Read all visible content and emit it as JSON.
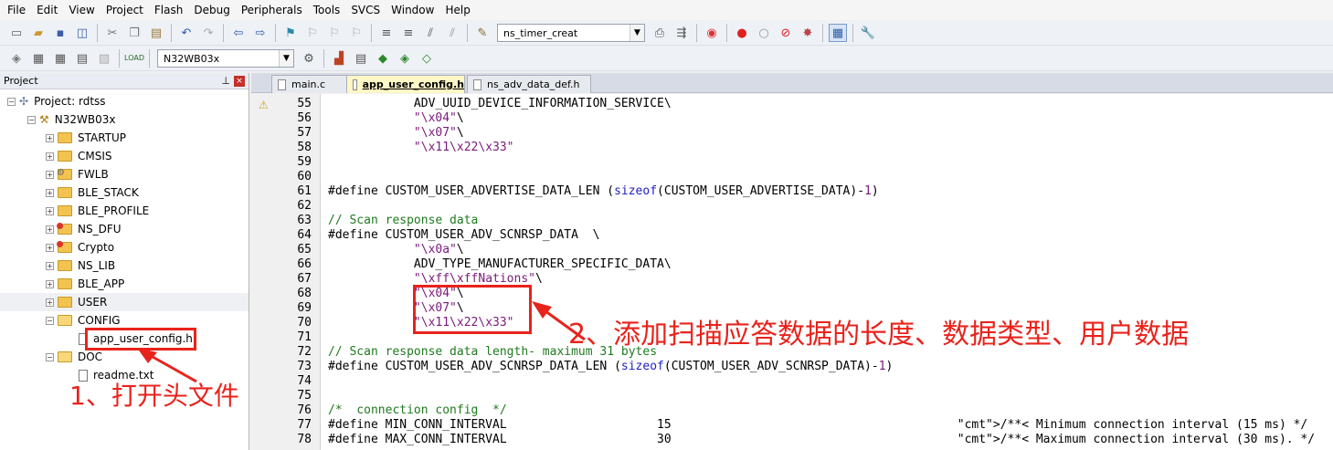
{
  "menu": [
    "File",
    "Edit",
    "View",
    "Project",
    "Flash",
    "Debug",
    "Peripherals",
    "Tools",
    "SVCS",
    "Window",
    "Help"
  ],
  "toolbar1": {
    "target_combo": "ns_timer_creat"
  },
  "toolbar2": {
    "device_combo": "N32WB03x"
  },
  "project_panel": {
    "title": "Project",
    "project_root": "Project: rdtss",
    "target": "N32WB03x",
    "groups": [
      "STARTUP",
      "CMSIS",
      "FWLB",
      "BLE_STACK",
      "BLE_PROFILE",
      "NS_DFU",
      "Crypto",
      "NS_LIB",
      "BLE_APP",
      "USER",
      "CONFIG",
      "DOC"
    ],
    "config_file": "app_user_config.h",
    "doc_file": "readme.txt"
  },
  "tabs": [
    "main.c",
    "app_user_config.h",
    "ns_adv_data_def.h"
  ],
  "code_lines": [
    {
      "n": "55",
      "t": "            ADV_UUID_DEVICE_INFORMATION_SERVICE\\"
    },
    {
      "n": "56",
      "t": "            \"\\x04\"\\"
    },
    {
      "n": "57",
      "t": "            \"\\x07\"\\"
    },
    {
      "n": "58",
      "t": "            \"\\x11\\x22\\x33\""
    },
    {
      "n": "59",
      "t": ""
    },
    {
      "n": "60",
      "t": ""
    },
    {
      "n": "61",
      "t": "#define CUSTOM_USER_ADVERTISE_DATA_LEN (sizeof(CUSTOM_USER_ADVERTISE_DATA)-1)"
    },
    {
      "n": "62",
      "t": ""
    },
    {
      "n": "63",
      "t": "// Scan response data"
    },
    {
      "n": "64",
      "t": "#define CUSTOM_USER_ADV_SCNRSP_DATA  \\"
    },
    {
      "n": "65",
      "t": "            \"\\x0a\"\\"
    },
    {
      "n": "66",
      "t": "            ADV_TYPE_MANUFACTURER_SPECIFIC_DATA\\"
    },
    {
      "n": "67",
      "t": "            \"\\xff\\xffNations\"\\"
    },
    {
      "n": "68",
      "t": "            \"\\x04\"\\"
    },
    {
      "n": "69",
      "t": "            \"\\x07\"\\"
    },
    {
      "n": "70",
      "t": "            \"\\x11\\x22\\x33\""
    },
    {
      "n": "71",
      "t": ""
    },
    {
      "n": "72",
      "t": "// Scan response data length- maximum 31 bytes"
    },
    {
      "n": "73",
      "t": "#define CUSTOM_USER_ADV_SCNRSP_DATA_LEN (sizeof(CUSTOM_USER_ADV_SCNRSP_DATA)-1)"
    },
    {
      "n": "74",
      "t": ""
    },
    {
      "n": "75",
      "t": ""
    },
    {
      "n": "76",
      "t": "/*  connection config  */"
    },
    {
      "n": "77",
      "t": "#define MIN_CONN_INTERVAL                     15                                        /**< Minimum connection interval (15 ms) */"
    },
    {
      "n": "78",
      "t": "#define MAX_CONN_INTERVAL                     30                                        /**< Maximum connection interval (30 ms). */"
    }
  ],
  "annotations": {
    "note1": "1、打开头文件",
    "note2": "2、添加扫描应答数据的长度、数据类型、用户数据"
  },
  "colors": {
    "annotation": "#e8231c",
    "active_tab": "#fff7c6"
  }
}
